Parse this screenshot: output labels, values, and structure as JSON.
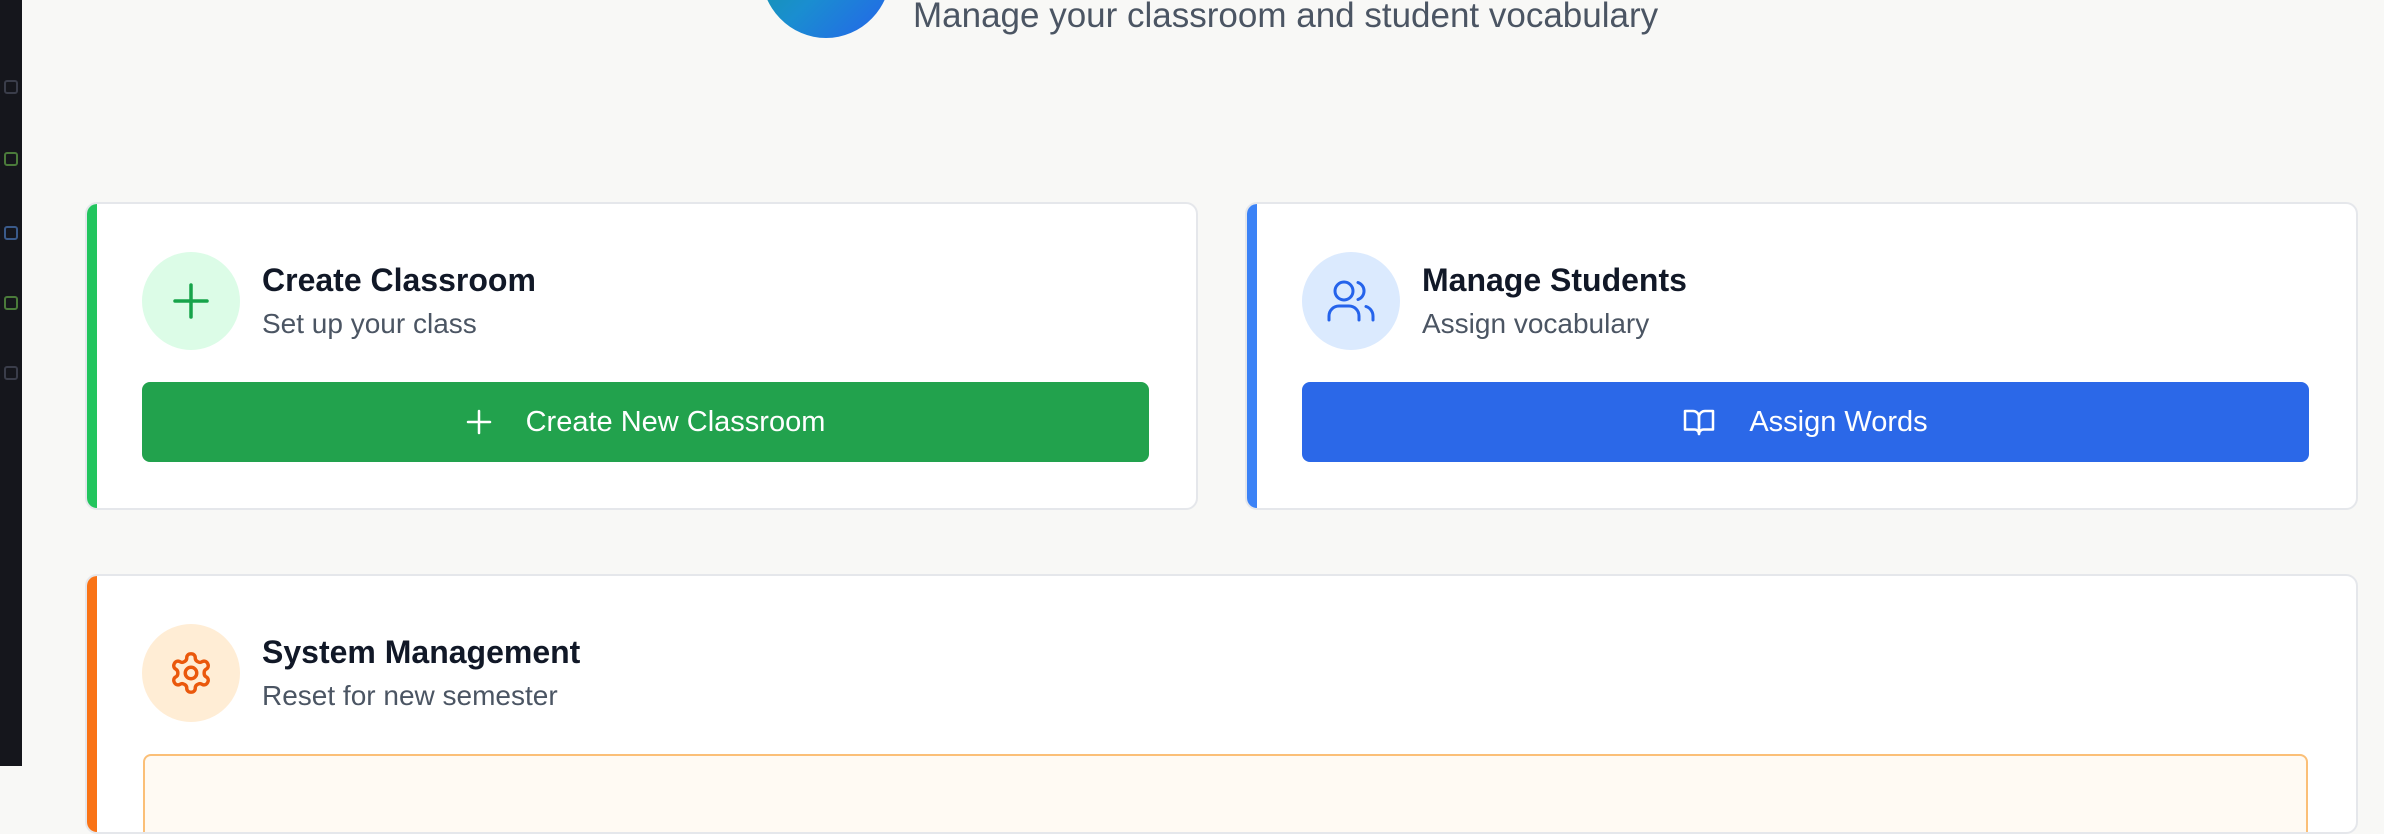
{
  "header": {
    "subtitle": "Manage your classroom and student vocabulary",
    "logo_icon": "app-logo"
  },
  "colors": {
    "green_accent": "#22c55e",
    "green_button": "#22a24d",
    "blue_accent": "#3b82f6",
    "blue_button": "#2b68e8",
    "orange_accent": "#f97316",
    "page_background": "#f8f8f6"
  },
  "cards": {
    "create": {
      "title": "Create Classroom",
      "subtitle": "Set up your class",
      "icon": "plus-icon",
      "button_label": "Create New Classroom",
      "button_icon": "plus-icon"
    },
    "manage": {
      "title": "Manage Students",
      "subtitle": "Assign vocabulary",
      "icon": "users-icon",
      "button_label": "Assign Words",
      "button_icon": "book-open-icon"
    },
    "system": {
      "title": "System Management",
      "subtitle": "Reset for new semester",
      "icon": "gear-icon"
    }
  }
}
